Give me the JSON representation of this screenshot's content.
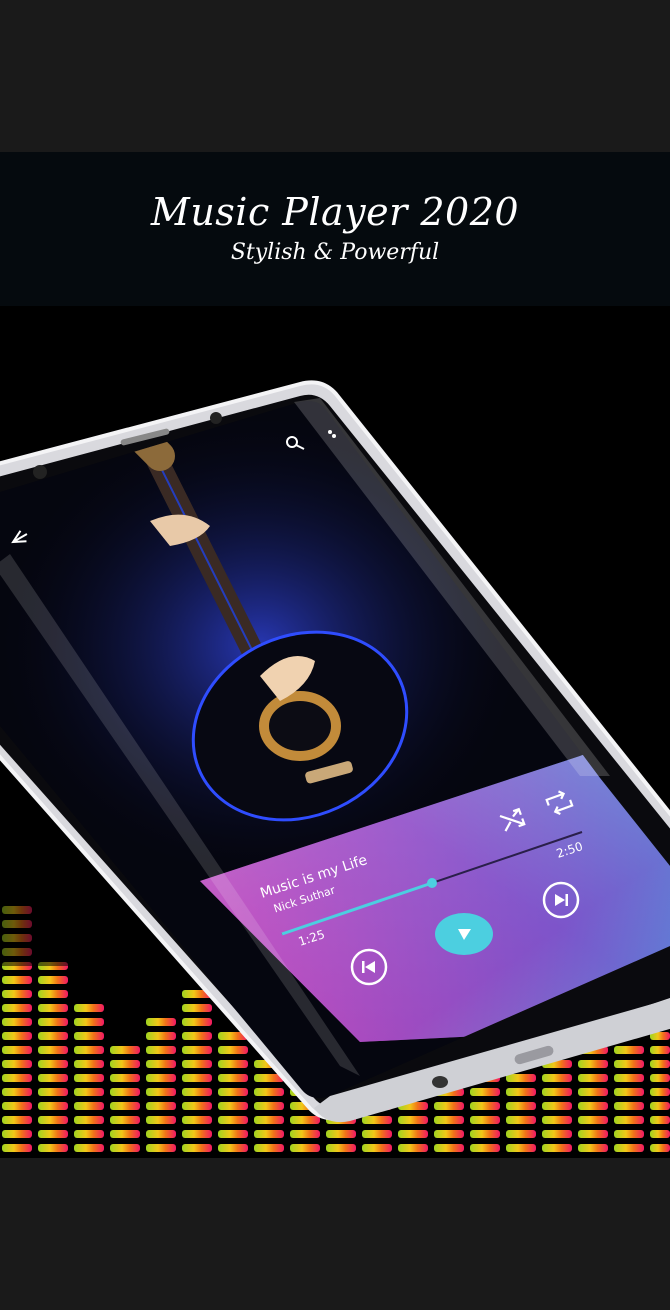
{
  "header": {
    "title": "Music Player 2020",
    "subtitle": "Stylish & Powerful"
  },
  "player": {
    "song_title": "Music is my Life",
    "artist": "Nick Suthar",
    "elapsed": "1:25",
    "duration": "2:50",
    "progress": 0.5
  },
  "icons": {
    "back": "arrow-left-icon",
    "search": "search-icon",
    "more": "more-vertical-icon",
    "shuffle": "shuffle-icon",
    "repeat": "repeat-icon",
    "previous": "skip-previous-icon",
    "play": "play-icon",
    "next": "skip-next-icon"
  },
  "colors": {
    "accent": "#4ccfe0",
    "gradient_top": "#29c4e6",
    "gradient_mid": "#7b4fc8",
    "gradient_bottom": "#e83fb0"
  }
}
